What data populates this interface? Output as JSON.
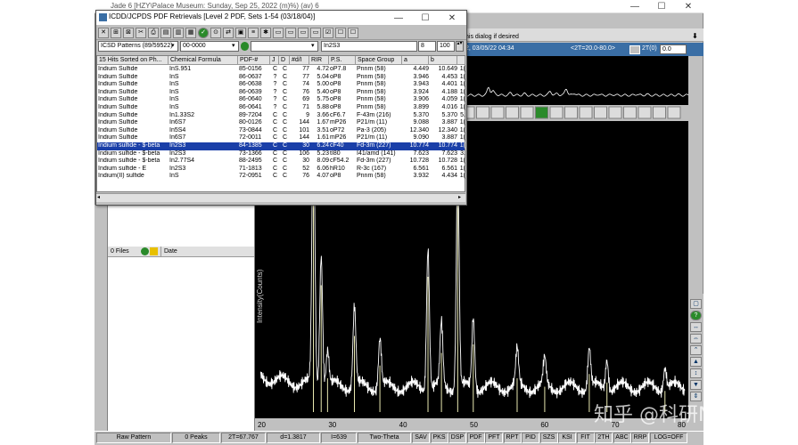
{
  "jade": {
    "title": "Jade 6 [HZY\\Palace Museum: Sunday, Sep 25, 2022 (m)%) (av) 6",
    "window_controls": [
      "—",
      "☐",
      "✕"
    ],
    "dialog_hint": "his dialog if desired",
    "toolbar_info": "<2T=20.0-80.0>",
    "toolbar_date": "2, 03/05/22 04:34",
    "two_t_label": "2T(0)",
    "two_t_value": "0.0",
    "y_axis_label": "Intensity(Counts)",
    "x_ticks": [
      "20",
      "30",
      "40",
      "50",
      "60",
      "70",
      "80"
    ]
  },
  "files_panel": {
    "count_label": "0 Files",
    "date_col": "Date"
  },
  "statusbar": {
    "pattern": "Raw Pattern",
    "peaks": "0 Peaks",
    "two_t": "2T=67.767",
    "d": "d=1.3817",
    "i": "I=639",
    "mode": "Two-Theta",
    "buttons": [
      "SAV",
      "PKS",
      "DSP",
      "PDF",
      "PFT",
      "RPT",
      "PID",
      "SZS",
      "KSI",
      "FIT",
      "2TH",
      "ABC",
      "RRP"
    ],
    "log": "LOG=OFF"
  },
  "pdf_dialog": {
    "title": "ICDD/JCPDS PDF Retrievals [Level 2 PDF, Sets 1-54 (03/18/04)]",
    "window_controls": [
      "—",
      "☐",
      "✕"
    ],
    "filter_db": "ICSD Patterns (89/59522)",
    "filter_id": "00-0000",
    "filter_formula": "In2S3",
    "filter_n": "8",
    "filter_pct": "100",
    "columns": [
      "15 Hits Sorted on Ph...",
      "Chemical Formula",
      "PDF-#",
      "J",
      "D",
      "#d/I",
      "RIR",
      "P.S.",
      "Space Group",
      "a",
      "b",
      ""
    ],
    "rows": [
      [
        "Indium Sulfide",
        "InS.951",
        "85-0156",
        "C",
        "C",
        "77",
        "4.72",
        "oP7.8",
        "Pnnm (58)",
        "4.449",
        "10.649",
        "1("
      ],
      [
        "Indium Sulfide",
        "InS",
        "86-0637",
        "?",
        "C",
        "77",
        "5.04",
        "oP8",
        "Pnnm (58)",
        "3.946",
        "4.453",
        "1("
      ],
      [
        "Indium Sulfide",
        "InS",
        "86-0638",
        "?",
        "C",
        "74",
        "5.00",
        "oP8",
        "Pnnm (58)",
        "3.943",
        "4.401",
        "1("
      ],
      [
        "Indium Sulfide",
        "InS",
        "86-0639",
        "?",
        "C",
        "76",
        "5.40",
        "oP8",
        "Pnnm (58)",
        "3.924",
        "4.188",
        "1("
      ],
      [
        "Indium Sulfide",
        "InS",
        "86-0640",
        "?",
        "C",
        "69",
        "5.75",
        "oP8",
        "Pnnm (58)",
        "3.906",
        "4.059",
        "1("
      ],
      [
        "Indium Sulfide",
        "InS",
        "86-0641",
        "?",
        "C",
        "71",
        "5.88",
        "oP8",
        "Pnnm (58)",
        "3.899",
        "4.016",
        "1("
      ],
      [
        "Indium Sulfide",
        "In1.33S2",
        "89-7204",
        "C",
        "C",
        "9",
        "3.66",
        "cF6.7",
        "F-43m (216)",
        "5.370",
        "5.370",
        "5."
      ],
      [
        "Indium Sulfide",
        "In6S7",
        "80-0126",
        "C",
        "C",
        "144",
        "1.67",
        "mP26",
        "P21/m (11)",
        "9.088",
        "3.887",
        "1("
      ],
      [
        "Indium Sulfide",
        "In5S4",
        "73-0844",
        "C",
        "C",
        "101",
        "3.51",
        "oP72",
        "Pa-3 (205)",
        "12.340",
        "12.340",
        "1("
      ],
      [
        "Indium Sulfide",
        "In6S7",
        "72-0011",
        "C",
        "C",
        "144",
        "1.61",
        "mP26",
        "P21/m (11)",
        "9.090",
        "3.887",
        "1("
      ],
      [
        "Indium sulfide - $-beta",
        "In2S3",
        "84-1385",
        "C",
        "C",
        "30",
        "6.24",
        "cF40",
        "Fd-3m (227)",
        "10.774",
        "10.774",
        "1("
      ],
      [
        "Indium sulfide - $-beta",
        "In2S3",
        "73-1366",
        "C",
        "C",
        "106",
        "5.23",
        "tI80",
        "I41/amd (141)",
        "7.623",
        "7.623",
        "3."
      ],
      [
        "Indium sulfide - $-beta",
        "In2.77S4",
        "88-2495",
        "C",
        "C",
        "30",
        "8.09",
        "cF54.2",
        "Fd-3m (227)",
        "10.728",
        "10.728",
        "1("
      ],
      [
        "Indium sulfide - E",
        "In2S3",
        "71-1813",
        "C",
        "C",
        "52",
        "6.06",
        "hR10",
        "R-3c (167)",
        "6.561",
        "6.561",
        "1("
      ],
      [
        "Indium(II) sulfide",
        "InS",
        "72-0951",
        "C",
        "C",
        "76",
        "4.07",
        "oP8",
        "Pnnm (58)",
        "3.932",
        "4.434",
        "1("
      ]
    ],
    "selected_row": 10
  },
  "watermark": "知乎 @科研N次方",
  "colors": {
    "plot_bg": "#000000",
    "trace": "#ffffff",
    "sticks": "#e8e8b0",
    "selection": "#1a3fa8",
    "titlebar": "#ffffff"
  }
}
